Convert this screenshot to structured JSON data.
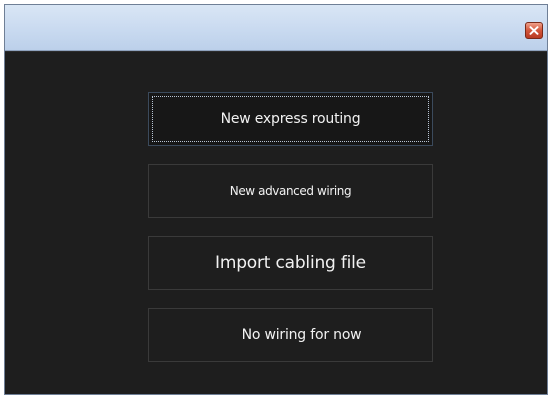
{
  "window": {
    "close_icon": "close-icon"
  },
  "options": [
    {
      "label": "New express routing"
    },
    {
      "label": "New advanced wiring"
    },
    {
      "label": "Import cabling file"
    },
    {
      "label": "No wiring for now"
    }
  ],
  "colors": {
    "background": "#1e1e1e",
    "border": "#3a3a3a",
    "text": "#f2f2f2",
    "titlebar": "#c9daf0",
    "close": "#d2553a"
  }
}
